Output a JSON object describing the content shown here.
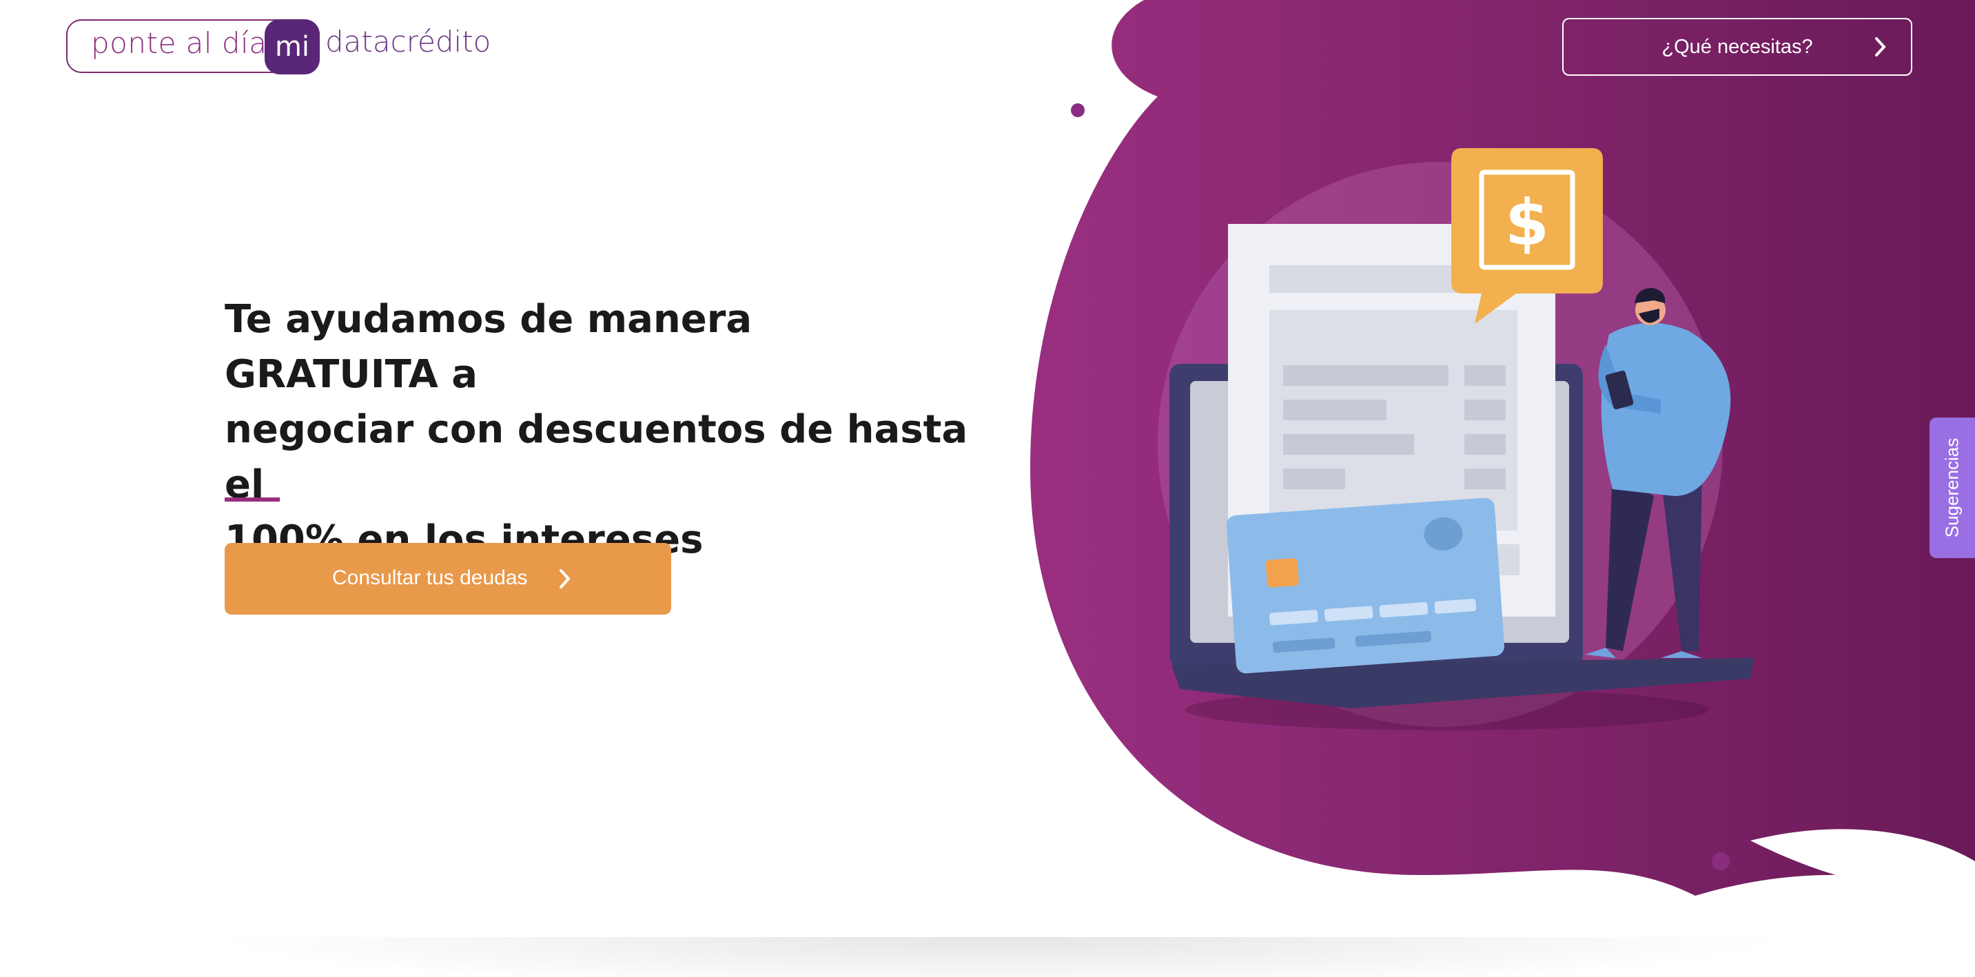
{
  "logo": {
    "tagline": "ponte al día",
    "mi": "mi",
    "brand": "datacrédito"
  },
  "header": {
    "need_button_label": "¿Qué necesitas?"
  },
  "hero": {
    "headline_lines": [
      "Te ayudamos de manera GRATUITA a",
      "negociar con descuentos de hasta el",
      "100% en los intereses"
    ],
    "cta_label": "Consultar tus deudas",
    "illustration_symbol": "$"
  },
  "sidebar_tab": {
    "label": "Sugerencias"
  },
  "colors": {
    "brand_purple": "#8a2c80",
    "dark_purple": "#5a2677",
    "cta_orange": "#e8994a",
    "tab_violet": "#9a6fe4"
  },
  "icons": [
    "chevron-right-icon",
    "dollar-icon",
    "credit-card-icon",
    "laptop-icon",
    "person-illustration"
  ]
}
